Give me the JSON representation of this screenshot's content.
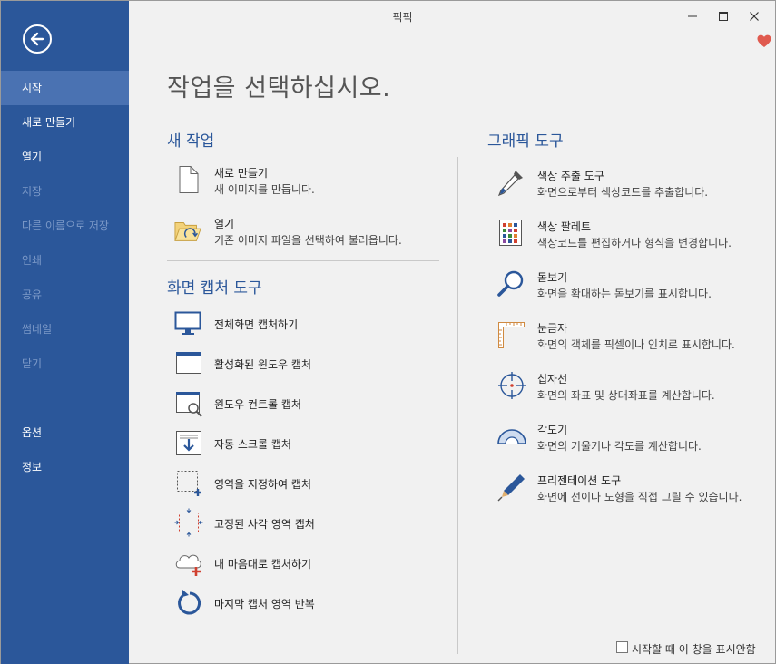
{
  "window": {
    "title": "픽픽"
  },
  "sidebar": {
    "items": [
      {
        "label": "시작"
      },
      {
        "label": "새로 만들기"
      },
      {
        "label": "열기"
      },
      {
        "label": "저장"
      },
      {
        "label": "다른 이름으로 저장"
      },
      {
        "label": "인쇄"
      },
      {
        "label": "공유"
      },
      {
        "label": "썸네일"
      },
      {
        "label": "닫기"
      },
      {
        "label": "옵션"
      },
      {
        "label": "정보"
      }
    ]
  },
  "main": {
    "title": "작업을 선택하십시오.",
    "new_task": {
      "heading": "새 작업",
      "items": [
        {
          "title": "새로 만들기",
          "desc": "새 이미지를 만듭니다."
        },
        {
          "title": "열기",
          "desc": "기존 이미지 파일을 선택하여 불러옵니다."
        }
      ]
    },
    "capture": {
      "heading": "화면 캡처 도구",
      "items": [
        {
          "title": "전체화면 캡처하기"
        },
        {
          "title": "활성화된 윈도우 캡처"
        },
        {
          "title": "윈도우 컨트롤 캡처"
        },
        {
          "title": "자동 스크롤 캡처"
        },
        {
          "title": "영역을 지정하여 캡처"
        },
        {
          "title": "고정된 사각 영역 캡처"
        },
        {
          "title": "내 마음대로 캡처하기"
        },
        {
          "title": "마지막 캡처 영역 반복"
        }
      ]
    },
    "graphic": {
      "heading": "그래픽 도구",
      "items": [
        {
          "title": "색상 추출 도구",
          "desc": "화면으로부터 색상코드를 추출합니다."
        },
        {
          "title": "색상 팔레트",
          "desc": "색상코드를 편집하거나 형식을 변경합니다."
        },
        {
          "title": "돋보기",
          "desc": "화면을 확대하는 돋보기를 표시합니다."
        },
        {
          "title": "눈금자",
          "desc": "화면의 객체를 픽셀이나 인치로 표시합니다."
        },
        {
          "title": "십자선",
          "desc": "화면의 좌표 및 상대좌표를 계산합니다."
        },
        {
          "title": "각도기",
          "desc": "화면의 기울기나 각도를 계산합니다."
        },
        {
          "title": "프리젠테이션 도구",
          "desc": "화면에 선이나 도형을 직접 그릴 수 있습니다."
        }
      ]
    },
    "startup_checkbox": {
      "label": "시작할 때 이 창을 표시안함",
      "checked": false
    }
  },
  "colors": {
    "sidebar": "#2b579a",
    "sidebar_active": "#4a72b2",
    "accent": "#2b579a",
    "heart": "#e05a4f"
  }
}
